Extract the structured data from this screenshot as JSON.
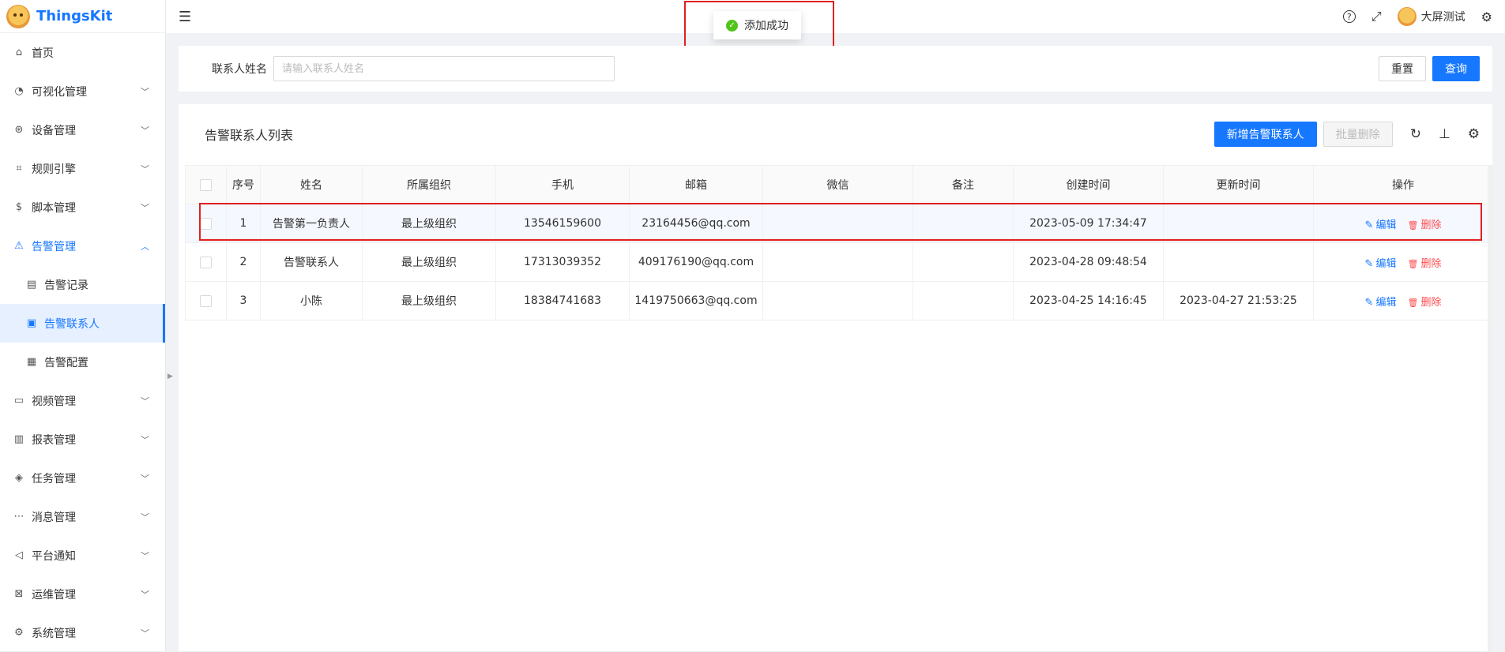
{
  "app": {
    "logo_text": "ThingsKit"
  },
  "sidebar": {
    "items": [
      {
        "label": "首页",
        "icon": "home-icon",
        "glyph": "⌂",
        "arrow": false
      },
      {
        "label": "可视化管理",
        "icon": "dashboard-icon",
        "glyph": "◔",
        "arrow": true
      },
      {
        "label": "设备管理",
        "icon": "device-icon",
        "glyph": "⊛",
        "arrow": true
      },
      {
        "label": "规则引擎",
        "icon": "rule-engine-icon",
        "glyph": "⌗",
        "arrow": true
      },
      {
        "label": "脚本管理",
        "icon": "script-icon",
        "glyph": "$",
        "arrow": true
      },
      {
        "label": "告警管理",
        "icon": "alarm-icon",
        "glyph": "⚠",
        "arrow": true,
        "open": true
      },
      {
        "label": "告警记录",
        "icon": "record-icon",
        "glyph": "▤",
        "sub": true
      },
      {
        "label": "告警联系人",
        "icon": "contact-icon",
        "glyph": "▣",
        "sub": true,
        "active": true
      },
      {
        "label": "告警配置",
        "icon": "config-icon",
        "glyph": "▦",
        "sub": true
      },
      {
        "label": "视频管理",
        "icon": "video-icon",
        "glyph": "▭",
        "arrow": true
      },
      {
        "label": "报表管理",
        "icon": "chart-icon",
        "glyph": "▥",
        "arrow": true
      },
      {
        "label": "任务管理",
        "icon": "tag-icon",
        "glyph": "◈",
        "arrow": true
      },
      {
        "label": "消息管理",
        "icon": "message-icon",
        "glyph": "⋯",
        "arrow": true
      },
      {
        "label": "平台通知",
        "icon": "notice-icon",
        "glyph": "◁",
        "arrow": true
      },
      {
        "label": "运维管理",
        "icon": "ops-icon",
        "glyph": "⊠",
        "arrow": true
      },
      {
        "label": "系统管理",
        "icon": "settings-icon",
        "glyph": "⚙",
        "arrow": true
      }
    ]
  },
  "topbar": {
    "username": "大屏测试",
    "icons": {
      "menu": "☰",
      "help": "?",
      "fullscreen": "⤢",
      "settings": "⚙"
    }
  },
  "toast": {
    "message": "添加成功",
    "check": "✓"
  },
  "search": {
    "label": "联系人姓名",
    "placeholder": "请输入联系人姓名",
    "value": "",
    "reset_label": "重置",
    "query_label": "查询"
  },
  "table": {
    "title": "告警联系人列表",
    "add_label": "新增告警联系人",
    "batch_delete_label": "批量删除",
    "tool_icons": {
      "refresh": "↻",
      "density": "⊥",
      "settings": "⚙"
    },
    "columns": [
      "序号",
      "姓名",
      "所属组织",
      "手机",
      "邮箱",
      "微信",
      "备注",
      "创建时间",
      "更新时间",
      "操作"
    ],
    "rows": [
      {
        "no": "1",
        "name": "告警第一负责人",
        "org": "最上级组织",
        "phone": "13546159600",
        "email": "23164456@qq.com",
        "wechat": "",
        "remark": "",
        "created": "2023-05-09 17:34:47",
        "updated": ""
      },
      {
        "no": "2",
        "name": "告警联系人",
        "org": "最上级组织",
        "phone": "17313039352",
        "email": "409176190@qq.com",
        "wechat": "",
        "remark": "",
        "created": "2023-04-28 09:48:54",
        "updated": ""
      },
      {
        "no": "3",
        "name": "小陈",
        "org": "最上级组织",
        "phone": "18384741683",
        "email": "1419750663@qq.com",
        "wechat": "",
        "remark": "",
        "created": "2023-04-25 14:16:45",
        "updated": "2023-04-27 21:53:25"
      }
    ],
    "edit_label": "编辑",
    "delete_label": "删除",
    "edit_glyph": "✎",
    "delete_glyph": "🗑"
  },
  "colors": {
    "primary": "#1677ff",
    "danger": "#ff4d4f",
    "success": "#52c41a",
    "highlight": "#e02020"
  }
}
